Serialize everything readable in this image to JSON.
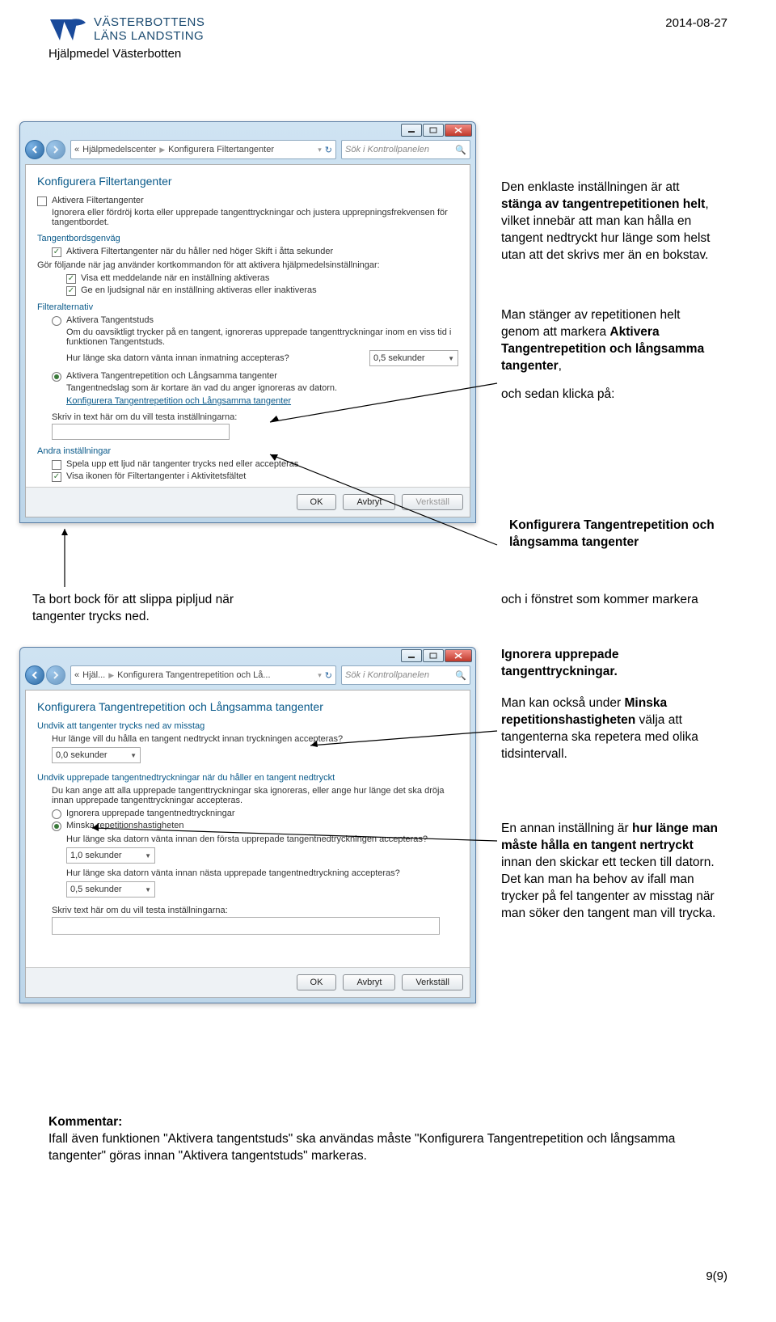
{
  "header": {
    "brand_line1": "VÄSTERBOTTENS",
    "brand_line2": "LÄNS LANDSTING",
    "subhead": "Hjälpmedel Västerbotten",
    "date": "2014-08-27"
  },
  "win1": {
    "crumb1": "Hjälpmedelscenter",
    "crumb2": "Konfigurera Filtertangenter",
    "search_ph": "Sök i Kontrollpanelen",
    "title": "Konfigurera Filtertangenter",
    "activate_label": "Aktivera Filtertangenter",
    "activate_desc": "Ignorera eller fördröj korta eller upprepade tangenttryckningar och justera upprepningsfrekvensen för tangentbordet.",
    "sec_shortcut": "Tangentbordsgenväg",
    "shortcut_chk": "Aktivera Filtertangenter när du håller ned höger Skift i åtta sekunder",
    "shortcut_desc": "Gör följande när jag använder kortkommandon för att aktivera hjälpmedelsinställningar:",
    "show_msg": "Visa ett meddelande när en inställning aktiveras",
    "sound_sig": "Ge en ljudsignal när en inställning aktiveras eller inaktiveras",
    "sec_filter": "Filteralternativ",
    "opt1_label": "Aktivera Tangentstuds",
    "opt1_desc": "Om du oavsiktligt trycker på en tangent, ignoreras upprepade tangenttryckningar inom en viss tid i funktionen Tangentstuds.",
    "wait_q": "Hur länge ska datorn vänta innan inmatning accepteras?",
    "wait_val": "0,5 sekunder",
    "opt2_label": "Aktivera Tangentrepetition och Långsamma tangenter",
    "opt2_desc": "Tangentnedslag som är kortare än vad du anger ignoreras av datorn.",
    "cfg_link": "Konfigurera Tangentrepetition och Långsamma tangenter",
    "test_label": "Skriv in text här om du vill testa inställningarna:",
    "sec_other": "Andra inställningar",
    "other1": "Spela upp ett ljud när tangenter trycks ned eller accepteras",
    "other2": "Visa ikonen för Filtertangenter i Aktivitetsfältet",
    "ok": "OK",
    "cancel": "Avbryt",
    "apply": "Verkställ"
  },
  "win2": {
    "crumb1": "Hjäl...",
    "crumb2": "Konfigurera Tangentrepetition och Lå...",
    "search_ph": "Sök i Kontrollpanelen",
    "title": "Konfigurera Tangentrepetition och Långsamma tangenter",
    "sec_avoid": "Undvik att tangenter trycks ned av misstag",
    "hold_q": "Hur länge vill du hålla en tangent nedtryckt innan tryckningen accepteras?",
    "hold_val": "0,0 sekunder",
    "sec_repeat": "Undvik upprepade tangentnedtryckningar när du håller en tangent nedtryckt",
    "repeat_desc": "Du kan ange att alla upprepade tangenttryckningar ska ignoreras, eller ange hur länge det ska dröja innan upprepade tangenttryckningar accepteras.",
    "ropt1": "Ignorera upprepade tangentnedtryckningar",
    "ropt2": "Minska repetitionshastigheten",
    "q1": "Hur länge ska datorn vänta innan den första upprepade tangentnedtryckningen accepteras?",
    "v1": "1,0 sekunder",
    "q2": "Hur länge ska datorn vänta innan nästa upprepade tangentnedtryckning accepteras?",
    "v2": "0,5 sekunder",
    "test_label": "Skriv text här om du vill testa inställningarna:",
    "ok": "OK",
    "cancel": "Avbryt",
    "apply": "Verkställ"
  },
  "rhs": {
    "p1a": "Den enklaste inställningen är att ",
    "p1b": "stänga av tangentrepetitionen helt",
    "p1c": ", vilket innebär att man kan hålla en tangent nedtryckt hur länge som helst utan att det skrivs mer än en bokstav.",
    "p2a": "Man stänger av repetitionen helt genom att markera ",
    "p2b": "Aktivera Tangentrepetition och långsamma tangenter",
    "p2c": ",",
    "p2d": "och sedan klicka på:",
    "p3": "Konfigurera Tangentrepetition och långsamma tangenter",
    "p4": "och i fönstret som kommer markera",
    "p5": "Ignorera upprepade tangenttryckningar.",
    "p6a": "Man kan också under ",
    "p6b": "Minska repetitionshastigheten",
    "p6c": " välja att tangenterna ska repetera med olika tidsintervall.",
    "p7a": "En annan inställning är ",
    "p7b": "hur länge man måste hålla en tangent nertryckt",
    "p7c": " innan den skickar ett tecken till datorn. Det kan man ha behov av ifall man trycker på fel tangenter av misstag när man söker den tangent man vill trycka."
  },
  "callout": {
    "text": "Ta bort bock för att slippa pipljud när tangenter trycks ned."
  },
  "footer": {
    "label": "Kommentar:",
    "text": "Ifall även funktionen \"Aktivera tangentstuds\" ska användas måste \"Konfigurera Tangentrepetition och långsamma tangenter\" göras innan \"Aktivera tangentstuds\" markeras."
  },
  "pagenum": "9(9)"
}
